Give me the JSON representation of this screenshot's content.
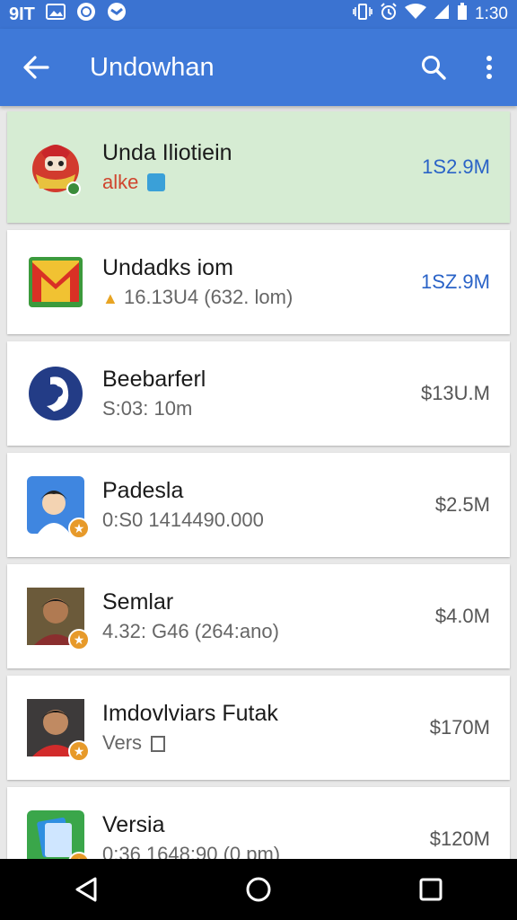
{
  "status_bar": {
    "carrier": "9IT",
    "time": "1:30"
  },
  "app_bar": {
    "title": "Undowhan"
  },
  "items": [
    {
      "name": "Unda Iliotiein",
      "sub": "alke",
      "price": "1S2.9M"
    },
    {
      "name": "Undadks iom",
      "sub": "16.13U4 (632. lom)",
      "price": "1SZ.9M"
    },
    {
      "name": "Beebarferl",
      "sub": "S:03: 10m",
      "price": "$13U.M"
    },
    {
      "name": "Padesla",
      "sub": "0:S0 1414490.000",
      "price": "$2.5M"
    },
    {
      "name": "Semlar",
      "sub": "4.32: G46 (264:ano)",
      "price": "$4.0M"
    },
    {
      "name": "Imdovlviars Futak",
      "sub": "Vers",
      "price": "$170M"
    },
    {
      "name": "Versia",
      "sub": "0:36 1648:90 (0 pm)",
      "price": "$120M"
    }
  ],
  "colors": {
    "status_bar": "#3b73d1",
    "app_bar": "#3f79d8",
    "highlight": "#d6ecd3",
    "price_blue": "#2a63c7"
  }
}
